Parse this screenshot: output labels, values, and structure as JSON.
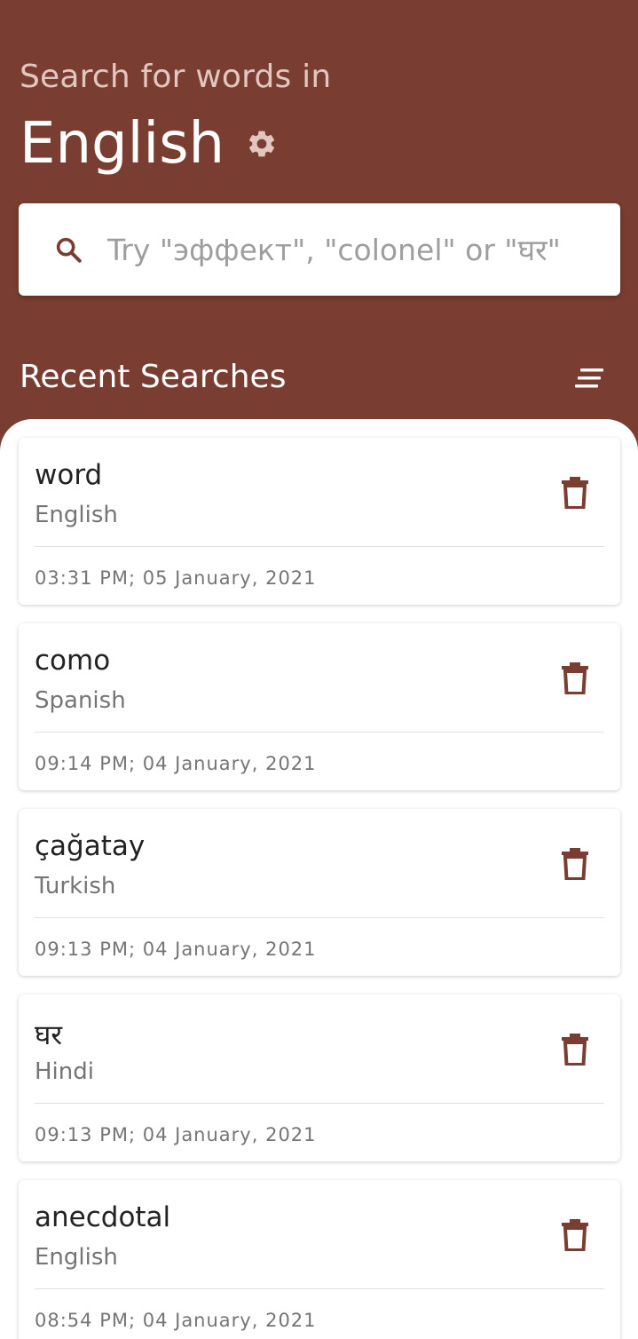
{
  "header": {
    "subtitle": "Search for words in",
    "language": "English"
  },
  "search": {
    "placeholder": "Try \"эффект\", \"colonel\" or \"घर\""
  },
  "recent": {
    "title": "Recent Searches",
    "items": [
      {
        "word": "word",
        "language": "English",
        "timestamp": "03:31 PM; 05 January, 2021"
      },
      {
        "word": "como",
        "language": "Spanish",
        "timestamp": "09:14 PM; 04 January, 2021"
      },
      {
        "word": "çağatay",
        "language": "Turkish",
        "timestamp": "09:13 PM; 04 January, 2021"
      },
      {
        "word": "घर",
        "language": "Hindi",
        "timestamp": "09:13 PM; 04 January, 2021"
      },
      {
        "word": "anecdotal",
        "language": "English",
        "timestamp": "08:54 PM; 04 January, 2021"
      }
    ]
  },
  "colors": {
    "primary": "#7a3d32",
    "accent_icon": "#7a3d32",
    "subtitle": "#e2c6c0"
  },
  "icons": {
    "settings": "gear-icon",
    "search": "search-icon",
    "sort": "sort-icon",
    "delete": "trash-icon"
  }
}
